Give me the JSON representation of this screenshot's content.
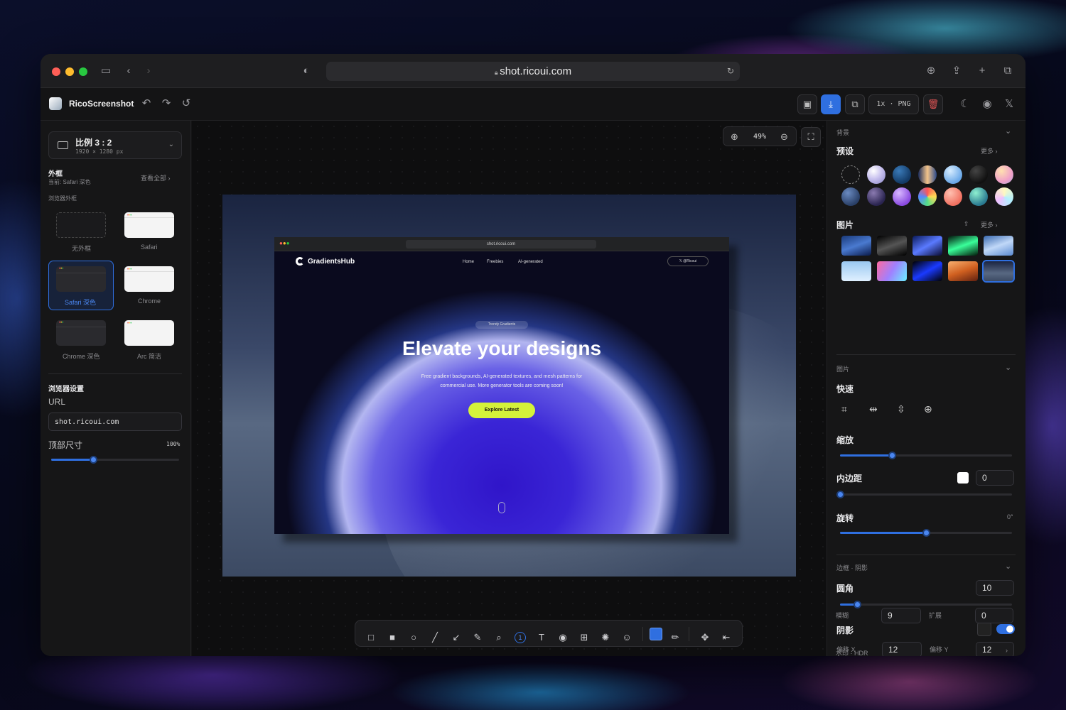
{
  "browser": {
    "url": "shot.ricoui.com"
  },
  "app": {
    "name": "RicoScreenshot",
    "scale_format": "1x · PNG"
  },
  "ratio": {
    "label": "比例 3 : 2",
    "size": "1920 × 1280 px"
  },
  "frame_section": {
    "title": "外框",
    "current": "当前: Safari 深色",
    "view_all": "查看全部",
    "group": "浏览器外框",
    "frames": [
      "无外框",
      "Safari",
      "Safari 深色",
      "Chrome",
      "Chrome 深色",
      "Arc 简洁"
    ]
  },
  "browser_settings": {
    "title": "浏览器设置",
    "url_label": "URL",
    "url_value": "shot.ricoui.com",
    "top_size_label": "顶部尺寸",
    "top_size_value": "100%",
    "top_size_level": 0.33
  },
  "canvas": {
    "zoom": "49%"
  },
  "preview": {
    "url": "shot.ricoui.com",
    "brand": "GradientsHub",
    "nav": [
      "Home",
      "Freebies",
      "AI-generated"
    ],
    "x_button": "@Ricoui",
    "badge": "Trendy Gradients",
    "headline": "Elevate your designs",
    "sub1": "Free gradient backgrounds, AI-generated textures, and mesh patterns for",
    "sub2": "commercial use. More generator tools are coming soon!",
    "cta": "Explore Latest"
  },
  "right": {
    "bg_section": "背景",
    "presets": "预设",
    "more": "更多",
    "images": "图片",
    "more2": "更多",
    "img_section": "图片",
    "quick": "快速",
    "scale": "缩放",
    "scale_level": 0.3,
    "padding": "内边距",
    "padding_value": "0",
    "padding_level": 0,
    "rotate": "旋转",
    "rotate_value": "0°",
    "rotate_level": 0.5,
    "border_section": "边框 · 阴影",
    "radius": "圆角",
    "radius_value": "10",
    "radius_level": 0.1,
    "shadow": "阴影",
    "offset_x": "偏移 X",
    "offset_x_value": "12",
    "offset_y": "偏移 Y",
    "offset_y_value": "12",
    "blur": "模糊",
    "blur_value": "9",
    "spread": "扩展",
    "spread_value": "0",
    "watermark": "水印 · HDR",
    "colors": {
      "accent": "#2f6fe0"
    }
  }
}
